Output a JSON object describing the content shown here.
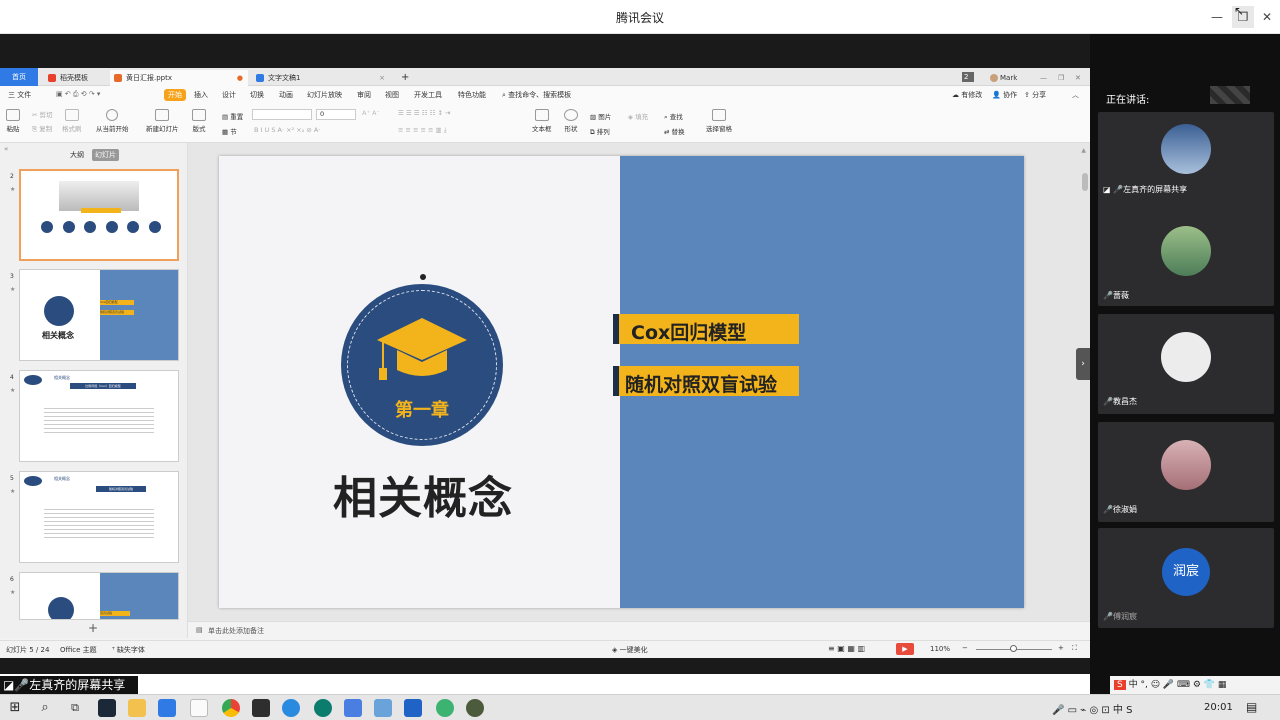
{
  "window": {
    "title": "腾讯会议"
  },
  "wps": {
    "tabs": [
      {
        "label": "首页"
      },
      {
        "label": "稻壳模板"
      },
      {
        "label": "黄日汇报.pptx"
      },
      {
        "label": "文字文稿1"
      }
    ],
    "tab_count": "2",
    "user": "Mark",
    "menus": [
      "三 文件",
      "开始",
      "插入",
      "设计",
      "切换",
      "动画",
      "幻灯片放映",
      "审阅",
      "视图",
      "开发工具",
      "特色功能"
    ],
    "search_label": "查找命令、搜索模板",
    "right_actions": [
      "有修改",
      "协作",
      "分享"
    ],
    "ribbon": {
      "paste": "粘贴",
      "cut": "剪切",
      "copy": "复制",
      "format_painter": "格式刷",
      "play_from_current": "从当前开始",
      "new_slide": "新建幻灯片",
      "layout": "版式",
      "section": "节",
      "reset": "重置",
      "font_size": "0",
      "textbox": "文本框",
      "shape": "形状",
      "arrange": "排列",
      "picture": "图片",
      "fill": "填充",
      "find": "查找",
      "replace": "替换",
      "select_pane": "选择窗格"
    },
    "left_tabs": {
      "outline": "大纲",
      "slides": "幻灯片"
    },
    "thumbs": [
      {
        "num": "2",
        "title": "",
        "chips": []
      },
      {
        "num": "3",
        "title": "相关概念",
        "chips": [
          "Cox回归模型",
          "随机对照双盲试验"
        ]
      },
      {
        "num": "4",
        "title": "相关概念",
        "chips": [
          "比例风险（Cox）回归模型"
        ]
      },
      {
        "num": "5",
        "title": "相关概念",
        "chips": [
          "随机对照双盲试验"
        ]
      },
      {
        "num": "6",
        "title": "",
        "chips": [
          "双盲试验"
        ]
      }
    ],
    "slide": {
      "chapter": "第一章",
      "title": "相关概念",
      "items": [
        "Cox回归模型",
        "随机对照双盲试验"
      ]
    },
    "notes_placeholder": "单击此处添加备注",
    "status": {
      "slide": "幻灯片 5 / 24",
      "theme": "Office 主题",
      "missing_font": "缺失字体",
      "beautify": "一键美化",
      "zoom": "110%"
    }
  },
  "meeting": {
    "speaking_label": "正在讲话:",
    "participants": [
      {
        "name": "左真齐的屏幕共享",
        "avatar_color": "#4f6f9c"
      },
      {
        "name": "蔷薇",
        "avatar_color": "#7aa06a"
      },
      {
        "name": "教昌杰",
        "avatar_color": "#e8e8e8"
      },
      {
        "name": "徐淑娟",
        "avatar_color": "#c99aa0"
      },
      {
        "name": "傅润宸",
        "avatar_text": "润宸",
        "avatar_color": "#1f63c6"
      }
    ],
    "share_label": "左真齐的屏幕共享"
  },
  "taskbar": {
    "time": "20:01",
    "ime": "中"
  },
  "colors": {
    "accent": "#f6a21a",
    "slide_blue": "#5b86bc",
    "navy": "#2b4c7e",
    "gold": "#f3b41b"
  }
}
